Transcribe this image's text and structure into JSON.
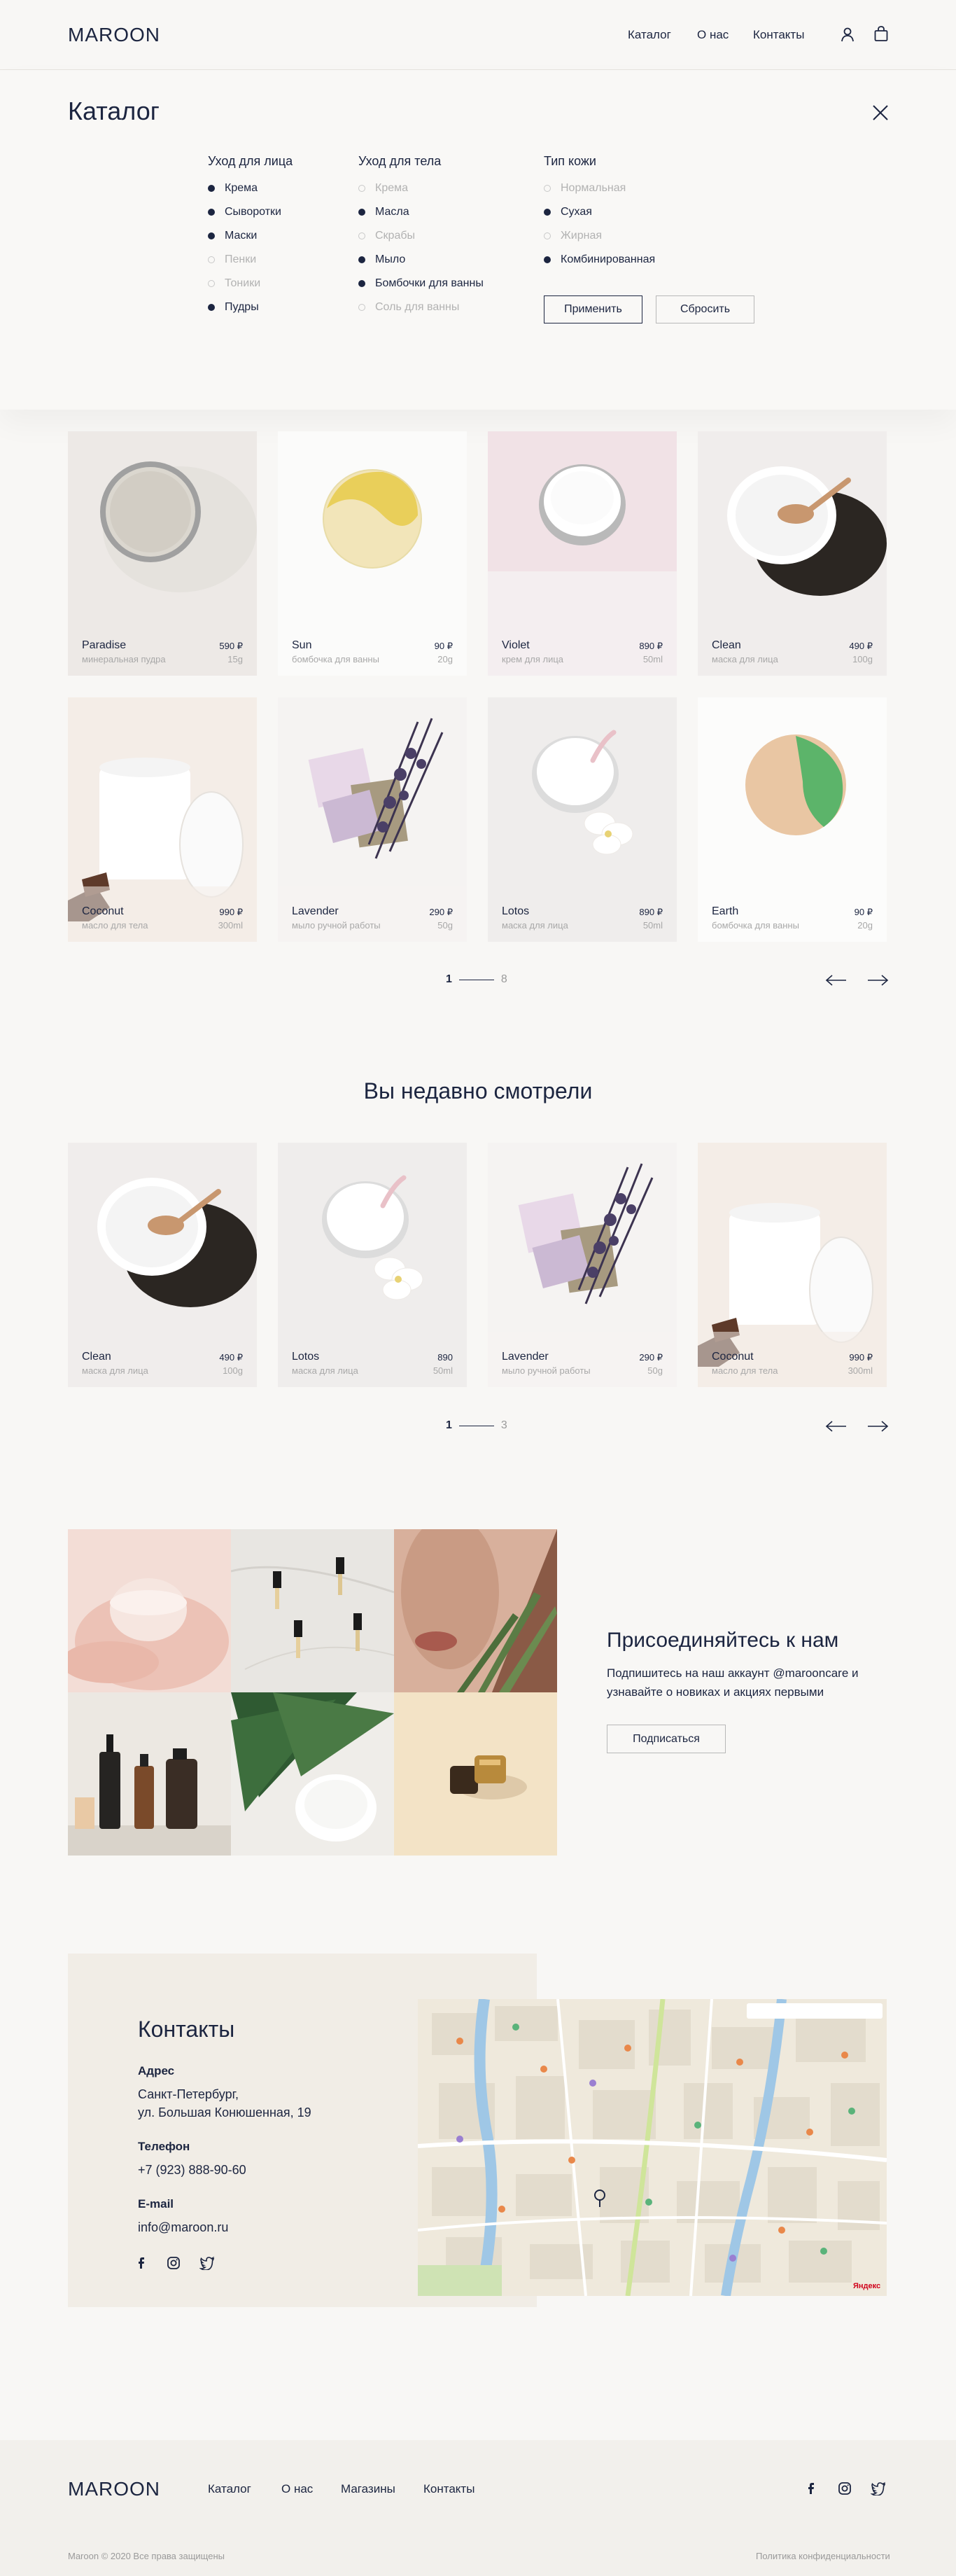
{
  "header": {
    "logo": "MAROON",
    "nav": [
      "Каталог",
      "О нас",
      "Контакты"
    ]
  },
  "catalog_panel": {
    "title": "Каталог",
    "columns": [
      {
        "title": "Уход для лица",
        "options": [
          {
            "label": "Крема",
            "checked": true
          },
          {
            "label": "Сыворотки",
            "checked": true
          },
          {
            "label": "Маски",
            "checked": true
          },
          {
            "label": "Пенки",
            "checked": false
          },
          {
            "label": "Тоники",
            "checked": false
          },
          {
            "label": "Пудры",
            "checked": true
          }
        ]
      },
      {
        "title": "Уход для тела",
        "options": [
          {
            "label": "Крема",
            "checked": false
          },
          {
            "label": "Масла",
            "checked": true
          },
          {
            "label": "Скрабы",
            "checked": false
          },
          {
            "label": "Мыло",
            "checked": true
          },
          {
            "label": "Бомбочки для ванны",
            "checked": true
          },
          {
            "label": "Соль для ванны",
            "checked": false
          }
        ]
      },
      {
        "title": "Тип кожи",
        "options": [
          {
            "label": "Нормальная",
            "checked": false
          },
          {
            "label": "Сухая",
            "checked": true
          },
          {
            "label": "Жирная",
            "checked": false
          },
          {
            "label": "Комбинированная",
            "checked": true
          }
        ]
      }
    ],
    "apply_label": "Применить",
    "reset_label": "Сбросить"
  },
  "products": [
    {
      "name": "Paradise",
      "price": "590 ₽",
      "type": "минеральная пудра",
      "size": "15g",
      "image": "compact-powder"
    },
    {
      "name": "Sun",
      "price": "90 ₽",
      "type": "бомбочка для ванны",
      "size": "20g",
      "image": "yellow-bath-bomb"
    },
    {
      "name": "Violet",
      "price": "890 ₽",
      "type": "крем для лица",
      "size": "50ml",
      "image": "cream-jar-pink"
    },
    {
      "name": "Clean",
      "price": "490 ₽",
      "type": "маска для лица",
      "size": "100g",
      "image": "mask-powder-spoon"
    },
    {
      "name": "Coconut",
      "price": "990 ₽",
      "type": "масло для тела",
      "size": "300ml",
      "image": "white-jar"
    },
    {
      "name": "Lavender",
      "price": "290 ₽",
      "type": "мыло ручной работы",
      "size": "50g",
      "image": "lavender-soap"
    },
    {
      "name": "Lotos",
      "price": "890 ₽",
      "type": "маска для лица",
      "size": "50ml",
      "image": "cream-flower"
    },
    {
      "name": "Earth",
      "price": "90 ₽",
      "type": "бомбочка для ванны",
      "size": "20g",
      "image": "green-bath-bomb"
    }
  ],
  "products_pager": {
    "current": "1",
    "total": "8"
  },
  "recent": {
    "title": "Вы недавно смотрели",
    "items": [
      {
        "name": "Clean",
        "price": "490 ₽",
        "type": "маска для лица",
        "size": "100g",
        "image": "mask-powder-spoon"
      },
      {
        "name": "Lotos",
        "price": "890",
        "type": "маска для лица",
        "size": "50ml",
        "image": "cream-flower"
      },
      {
        "name": "Lavender",
        "price": "290 ₽",
        "type": "мыло ручной работы",
        "size": "50g",
        "image": "lavender-soap"
      },
      {
        "name": "Coconut",
        "price": "990 ₽",
        "type": "масло для тела",
        "size": "300ml",
        "image": "white-jar"
      }
    ],
    "pager": {
      "current": "1",
      "total": "3"
    }
  },
  "join": {
    "title": "Присоединяйтесь к нам",
    "text": "Подпишитесь на наш аккаунт @marooncare и узнавайте о новиках и акциях первыми",
    "button": "Подписаться"
  },
  "contacts": {
    "title": "Контакты",
    "address_label": "Адрес",
    "address_line1": "Санкт-Петербург,",
    "address_line2": "ул. Большая Конюшенная, 19",
    "phone_label": "Телефон",
    "phone": "+7 (923) 888-90-60",
    "email_label": "E-mail",
    "email": "info@maroon.ru",
    "map_attribution": "Яндекс"
  },
  "footer": {
    "logo": "MAROON",
    "nav": [
      "Каталог",
      "О нас",
      "Магазины",
      "Контакты"
    ],
    "copyright": "Maroon © 2020 Все права защищены",
    "policy": "Политика конфиденциальности"
  },
  "colors": {
    "primary": "#1c2540",
    "background": "#f8f7f5",
    "card": "#f1efec",
    "muted": "#a8a8a8"
  }
}
